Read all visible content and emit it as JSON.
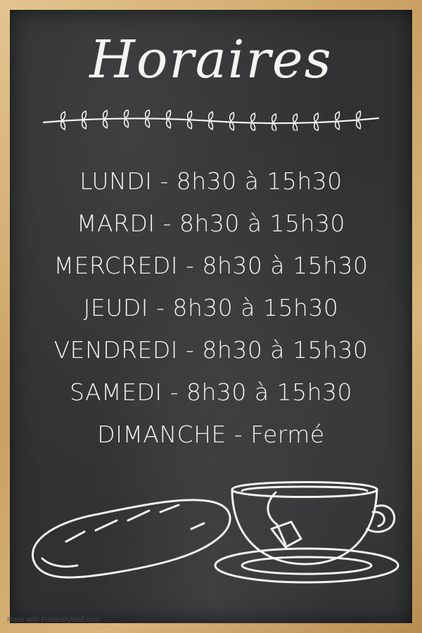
{
  "title": "Horaires",
  "schedule": [
    {
      "text": "LUNDI - 8h30 à 15h30"
    },
    {
      "text": "MARDI - 8h30 à 15h30"
    },
    {
      "text": "MERCREDI - 8h30 à 15h30"
    },
    {
      "text": "JEUDI - 8h30 à 15h30"
    },
    {
      "text": "VENDREDI - 8h30 à 15h30"
    },
    {
      "text": "SAMEDI - 8h30 à 15h30"
    },
    {
      "text": "DIMANCHE - Fermé"
    }
  ],
  "watermark": "Made with PosterMyWall.com",
  "colors": {
    "chalk": "#f2f2ef",
    "board": "#2f3133",
    "frame": "#caa063"
  },
  "icons": [
    "vine-divider-icon",
    "baguette-icon",
    "tea-cup-icon"
  ]
}
